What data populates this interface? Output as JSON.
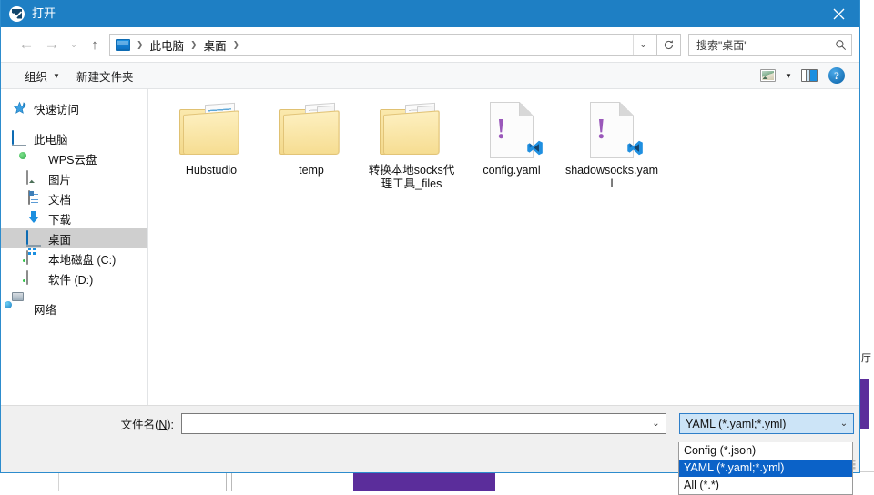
{
  "window": {
    "title": "打开",
    "title_icon": "checkmark-circle-icon",
    "close_label": "×",
    "accent_color": "#1e7fc4"
  },
  "nav": {
    "back_label": "←",
    "forward_label": "→",
    "history_caret": "⌄",
    "up_label": "↑",
    "breadcrumb": {
      "root_icon": "this-pc-monitor-icon",
      "separator": "❯",
      "items": [
        "此电脑",
        "桌面"
      ],
      "dropdown_caret": "⌄"
    },
    "refresh_label": "↻",
    "search": {
      "placeholder": "搜索\"桌面\"",
      "icon": "search-icon"
    }
  },
  "toolbar": {
    "organize_label": "组织",
    "organize_caret": "▼",
    "new_folder_label": "新建文件夹",
    "view_icon": "picture-view-icon",
    "view_caret": "▼",
    "preview_pane_icon": "preview-pane-icon",
    "help_icon": "help-icon",
    "help_label": "?"
  },
  "sidebar": {
    "items": [
      {
        "label": "快速访问",
        "icon": "pin-star-icon",
        "indent": false,
        "selected": false
      },
      {
        "label": "此电脑",
        "icon": "this-pc-icon",
        "indent": false,
        "selected": false
      },
      {
        "label": "WPS云盘",
        "icon": "wps-cloud-icon",
        "indent": true,
        "selected": false
      },
      {
        "label": "图片",
        "icon": "pictures-icon",
        "indent": true,
        "selected": false
      },
      {
        "label": "文档",
        "icon": "documents-icon",
        "indent": true,
        "selected": false
      },
      {
        "label": "下载",
        "icon": "downloads-icon",
        "indent": true,
        "selected": false
      },
      {
        "label": "桌面",
        "icon": "desktop-icon",
        "indent": true,
        "selected": true
      },
      {
        "label": "本地磁盘 (C:)",
        "icon": "local-disk-icon",
        "indent": true,
        "selected": false
      },
      {
        "label": "软件 (D:)",
        "icon": "drive-icon",
        "indent": true,
        "selected": false
      },
      {
        "label": "网络",
        "icon": "network-icon",
        "indent": false,
        "selected": false
      }
    ]
  },
  "files": [
    {
      "name": "Hubstudio",
      "type": "folder",
      "variant": "photos"
    },
    {
      "name": "temp",
      "type": "folder",
      "variant": "docs"
    },
    {
      "name": "转换本地socks代理工具_files",
      "type": "folder",
      "variant": "docs"
    },
    {
      "name": "config.yaml",
      "type": "yaml",
      "variant": "vscode"
    },
    {
      "name": "shadowsocks.yaml",
      "type": "yaml",
      "variant": "vscode"
    }
  ],
  "bottom": {
    "filename_label_prefix": "文件名(",
    "filename_label_accel": "N",
    "filename_label_suffix": "):",
    "filename_value": "",
    "filename_caret": "⌄",
    "filetype_selected": "YAML (*.yaml;*.yml)",
    "filetype_caret": "⌄",
    "filetype_options": [
      {
        "label": "Config (*.json)",
        "selected": false
      },
      {
        "label": "YAML (*.yaml;*.yml)",
        "selected": true
      },
      {
        "label": "All (*.*)",
        "selected": false
      }
    ],
    "highlight_color": "#0b62c8"
  },
  "background": {
    "text_fragment": "厅",
    "purple_color": "#5b2d9b"
  }
}
